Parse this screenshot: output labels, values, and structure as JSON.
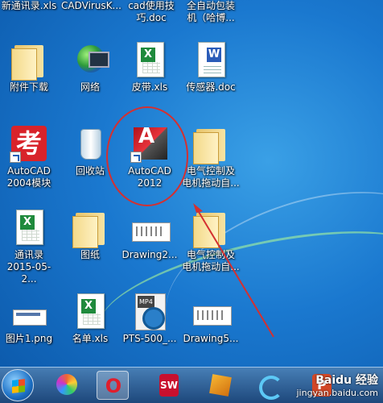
{
  "top_row": [
    {
      "label": "新通讯录.xls"
    },
    {
      "label": "CADVirusK..."
    },
    {
      "label": "cad使用技\n巧.doc"
    },
    {
      "label": "全自动包装\n机（哈博..."
    }
  ],
  "icons": [
    {
      "label": "附件下载",
      "icon": "folder-icon"
    },
    {
      "label": "网络",
      "icon": "network-icon"
    },
    {
      "label": "皮带.xls",
      "icon": "excel-file-icon"
    },
    {
      "label": "传感器.doc",
      "icon": "word-file-icon"
    },
    {
      "label": "AutoCAD\n2004模块",
      "icon": "kao-app-icon"
    },
    {
      "label": "回收站",
      "icon": "recycle-bin-icon"
    },
    {
      "label": "AutoCAD\n2012",
      "icon": "autocad-icon"
    },
    {
      "label": "电气控制及\n电机拖动自...",
      "icon": "folder-icon"
    },
    {
      "label": "通讯录\n2015-05-2...",
      "icon": "excel-file-icon"
    },
    {
      "label": "图纸",
      "icon": "folder-icon"
    },
    {
      "label": "Drawing2...",
      "icon": "drawing-thumbnail-icon"
    },
    {
      "label": "电气控制及\n电机拖动自...",
      "icon": "folder-icon"
    },
    {
      "label": "图片1.png",
      "icon": "image-thumbnail-icon"
    },
    {
      "label": "名单.xls",
      "icon": "excel-file-icon"
    },
    {
      "label": "PTS-500_...",
      "icon": "mp4-file-icon"
    },
    {
      "label": "Drawing5...",
      "icon": "drawing-thumbnail-icon"
    }
  ],
  "taskbar": {
    "items": [
      {
        "name": "start-button-icon"
      },
      {
        "name": "colorful-app-icon",
        "glyph": ""
      },
      {
        "name": "opera-icon",
        "glyph": "O"
      },
      {
        "name": "solidworks-icon",
        "glyph": "SW"
      },
      {
        "name": "software-box-icon",
        "glyph": ""
      },
      {
        "name": "refresh-app-icon",
        "glyph": ""
      },
      {
        "name": "powerpoint-icon",
        "glyph": "P"
      }
    ]
  },
  "watermark": {
    "line1": "Baidu 经验",
    "line2": "jingyan.baidu.com"
  },
  "colors": {
    "annotation": "#d43030",
    "desktop": "#1a78cf"
  }
}
